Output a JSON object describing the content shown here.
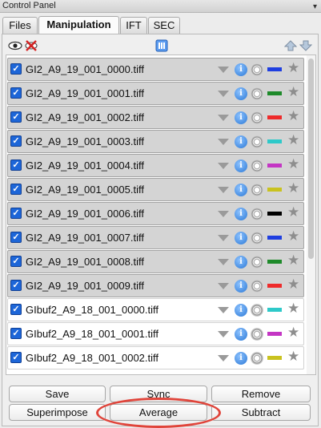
{
  "window": {
    "title": "Control Panel",
    "pin_icon": "pin-icon"
  },
  "tabs": [
    {
      "label": "Files",
      "active": false
    },
    {
      "label": "Manipulation",
      "active": true
    },
    {
      "label": "IFT",
      "active": false
    },
    {
      "label": "SEC",
      "active": false
    }
  ],
  "toolbar": {
    "icons": [
      "eye-icon",
      "hide-icon",
      "columns-icon",
      "move-up-icon",
      "move-down-icon"
    ]
  },
  "rows": [
    {
      "name": "GI2_A9_19_001_0000.tiff",
      "checked": true,
      "selected": true,
      "color": "#1f3fe0"
    },
    {
      "name": "GI2_A9_19_001_0001.tiff",
      "checked": true,
      "selected": true,
      "color": "#1e8a2a"
    },
    {
      "name": "GI2_A9_19_001_0002.tiff",
      "checked": true,
      "selected": true,
      "color": "#ee2b2b"
    },
    {
      "name": "GI2_A9_19_001_0003.tiff",
      "checked": true,
      "selected": true,
      "color": "#2ec9c9"
    },
    {
      "name": "GI2_A9_19_001_0004.tiff",
      "checked": true,
      "selected": true,
      "color": "#c436c4"
    },
    {
      "name": "GI2_A9_19_001_0005.tiff",
      "checked": true,
      "selected": true,
      "color": "#c9c21f"
    },
    {
      "name": "GI2_A9_19_001_0006.tiff",
      "checked": true,
      "selected": true,
      "color": "#000000"
    },
    {
      "name": "GI2_A9_19_001_0007.tiff",
      "checked": true,
      "selected": true,
      "color": "#1f3fe0"
    },
    {
      "name": "GI2_A9_19_001_0008.tiff",
      "checked": true,
      "selected": true,
      "color": "#1e8a2a"
    },
    {
      "name": "GI2_A9_19_001_0009.tiff",
      "checked": true,
      "selected": true,
      "color": "#ee2b2b"
    },
    {
      "name": "GIbuf2_A9_18_001_0000.tiff",
      "checked": true,
      "selected": false,
      "color": "#2ec9c9"
    },
    {
      "name": "GIbuf2_A9_18_001_0001.tiff",
      "checked": true,
      "selected": false,
      "color": "#c436c4"
    },
    {
      "name": "GIbuf2_A9_18_001_0002.tiff",
      "checked": true,
      "selected": false,
      "color": "#c9c21f"
    }
  ],
  "buttons": {
    "save": "Save",
    "sync": "Sync",
    "remove": "Remove",
    "superimpose": "Superimpose",
    "average": "Average",
    "subtract": "Subtract"
  },
  "colors": {
    "accent": "#1d66d8",
    "selected_row": "#d4d4d4",
    "annotation": "#e0443a"
  }
}
